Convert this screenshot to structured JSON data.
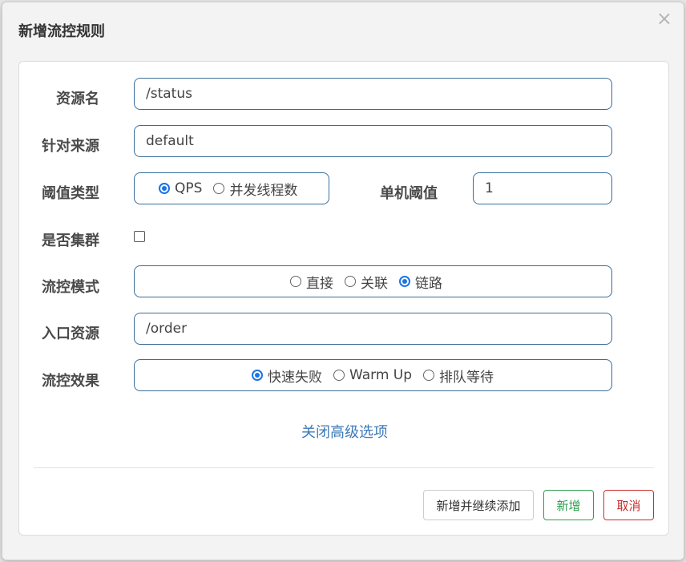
{
  "dialog": {
    "title": "新增流控规则",
    "close_icon": "×"
  },
  "form": {
    "resource": {
      "label": "资源名",
      "value": "/status"
    },
    "limit_app": {
      "label": "针对来源",
      "value": "default"
    },
    "grade": {
      "label": "阈值类型",
      "options": [
        "QPS",
        "并发线程数"
      ],
      "selected": "QPS"
    },
    "count": {
      "label": "单机阈值",
      "value": "1"
    },
    "cluster": {
      "label": "是否集群",
      "checked": false
    },
    "strategy": {
      "label": "流控模式",
      "options": [
        "直接",
        "关联",
        "链路"
      ],
      "selected": "链路"
    },
    "ref_resource": {
      "label": "入口资源",
      "value": "/order"
    },
    "control_behavior": {
      "label": "流控效果",
      "options": [
        "快速失败",
        "Warm Up",
        "排队等待"
      ],
      "selected": "快速失败"
    },
    "advanced_link": "关闭高级选项"
  },
  "footer": {
    "add_continue_label": "新增并继续添加",
    "add_label": "新增",
    "cancel_label": "取消"
  },
  "colors": {
    "input_border": "#3a6d9a",
    "radio_selected": "#1a73e8",
    "link": "#3d7ab8",
    "success": "#2e9e4f",
    "danger": "#c9302c"
  }
}
